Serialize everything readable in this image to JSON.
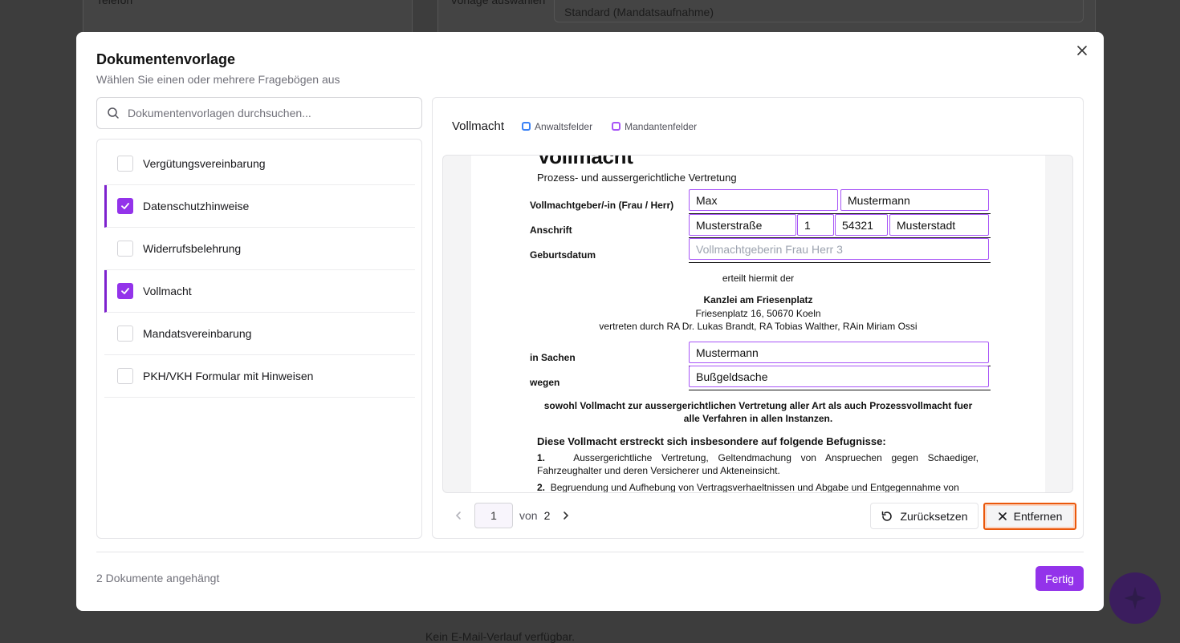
{
  "background": {
    "phone_label": "Telefon",
    "template_select_label": "Vorlage auswählen",
    "template_select_value": "Standard (Mandatsaufnahme)",
    "email_history_empty": "Kein E-Mail-Verlauf verfügbar."
  },
  "modal": {
    "title": "Dokumentenvorlage",
    "subtitle": "Wählen Sie einen oder mehrere Fragebögen aus",
    "close_icon": "close-icon",
    "search": {
      "placeholder": "Dokumentenvorlagen durchsuchen...",
      "value": ""
    },
    "templates": [
      {
        "label": "Vergütungsvereinbarung",
        "checked": false
      },
      {
        "label": "Datenschutzhinweise",
        "checked": true
      },
      {
        "label": "Widerrufsbelehrung",
        "checked": false
      },
      {
        "label": "Vollmacht",
        "checked": true
      },
      {
        "label": "Mandatsvereinbarung",
        "checked": false
      },
      {
        "label": "PKH/VKH Formular mit Hinweisen",
        "checked": false
      }
    ],
    "preview": {
      "title": "Vollmacht",
      "legend": {
        "lawyer_fields": "Anwaltsfelder",
        "client_fields": "Mandantenfelder"
      },
      "legend_colors": {
        "lawyer": "#3b82f6",
        "client": "#a855f7"
      },
      "document": {
        "heading": "Vollmacht",
        "subheading": "Prozess- und aussergerichtliche Vertretung",
        "label_grantor": "Vollmachtgeber/-in (Frau / Herr)",
        "label_address": "Anschrift",
        "label_birthdate": "Geburtsdatum",
        "first_name": "Max",
        "last_name": "Mustermann",
        "street": "Musterstraße",
        "house_number": "1",
        "zip": "54321",
        "city": "Musterstadt",
        "birthdate_placeholder": "Vollmachtgeberin Frau Herr 3",
        "grants_text": "erteilt hiermit der",
        "firm_name": "Kanzlei am Friesenplatz",
        "firm_address": "Friesenplatz 16, 50670 Koeln",
        "firm_representatives": "vertreten durch RA Dr. Lukas Brandt, RA Tobias Walther, RAin Miriam Ossi",
        "label_matter": "in Sachen",
        "label_regarding": "wegen",
        "matter": "Mustermann",
        "regarding": "Bußgeldsache",
        "scope_line1": "sowohl Vollmacht zur aussergerichtlichen Vertretung aller Art als auch Prozessvollmacht fuer",
        "scope_line2": "alle Verfahren in allen Instanzen.",
        "powers_heading": "Diese Vollmacht erstreckt sich insbesondere auf folgende Befugnisse:",
        "power_1_num": "1.",
        "power_1": "Aussergerichtliche Vertretung, Geltendmachung von Anspruechen gegen Schaediger, Fahrzeughalter und deren Versicherer und Akteneinsicht.",
        "power_2_num": "2.",
        "power_2": "Begruendung und Aufhebung von Vertragsverhaeltnissen und Abgabe und Entgegennahme von"
      },
      "pagination": {
        "current": "1",
        "of_label": "von",
        "total": "2"
      },
      "reset_label": "Zurücksetzen",
      "remove_label": "Entfernen"
    },
    "footer": {
      "attached_count": "2 Dokumente angehängt",
      "done_label": "Fertig"
    }
  }
}
